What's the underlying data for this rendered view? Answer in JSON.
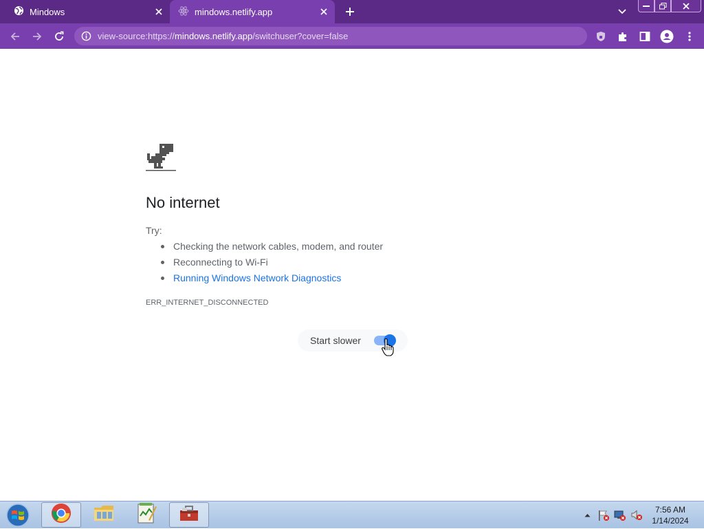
{
  "browser": {
    "tabs": [
      {
        "title": "Mindows",
        "icon": "globe-icon"
      },
      {
        "title": "mindows.netlify.app",
        "icon": "react-logo-icon"
      }
    ],
    "url_prefix": "view-source:https://",
    "url_host": "mindows.netlify.app",
    "url_path": "/switchuser?cover=false"
  },
  "error_page": {
    "title": "No internet",
    "try_label": "Try:",
    "suggestions": [
      "Checking the network cables, modem, and router",
      "Reconnecting to Wi-Fi"
    ],
    "diagnostics_link": "Running Windows Network Diagnostics",
    "error_code": "ERR_INTERNET_DISCONNECTED",
    "start_slower_label": "Start slower",
    "start_slower_enabled": true
  },
  "taskbar": {
    "apps": [
      "chrome-icon",
      "file-explorer-icon",
      "notepad-icon",
      "toolbox-icon"
    ],
    "time": "7:56 AM",
    "date": "1/14/2024"
  },
  "colors": {
    "tab_bar": "#5b2a86",
    "toolbar": "#7a3fae",
    "link": "#1a73e8"
  }
}
